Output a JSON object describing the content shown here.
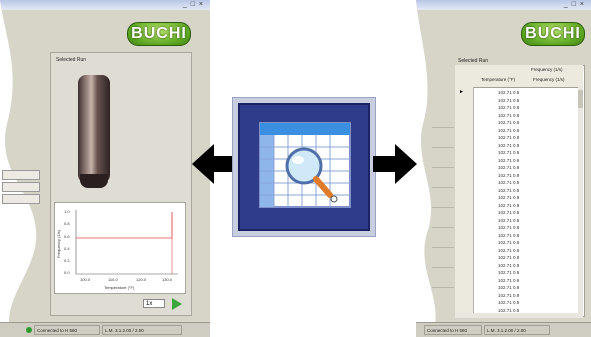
{
  "left_window": {
    "window_controls": "_ □ ×",
    "logo_text": "BUCHI",
    "panel_title": "Selected Run",
    "chart": {
      "ylabel": "Frequency (1/s)",
      "xlabel": "Temperature (°F)",
      "yticks": [
        "1.0",
        "0.8",
        "0.6",
        "0.4",
        "0.2",
        "0.0"
      ],
      "xticks": [
        "100.0",
        "110.0",
        "120.0",
        "130.0"
      ]
    },
    "zoom_value": "1x",
    "side_tabs": [
      "",
      "",
      ""
    ],
    "status": {
      "connection": "Connected to H 560",
      "info": "L.M. 3.1.2.00 / 2.00"
    }
  },
  "right_window": {
    "window_controls": "_ □ ×",
    "logo_text": "BUCHI",
    "panel_title": "Selected Run",
    "columns": [
      "Temperature (°F)",
      "Frequency (1/s)"
    ],
    "column_group": "Frequency (1/s)",
    "row_marker": "►",
    "rows": [
      "102.71 0.9",
      "102.71 0.9",
      "102.71 0.9",
      "102.71 0.9",
      "102.71 0.9",
      "102.71 0.9",
      "102.71 0.9",
      "102.71 0.9",
      "102.71 0.9",
      "102.71 0.9",
      "102.71 0.9",
      "102.71 0.9",
      "102.71 0.9",
      "102.71 0.9",
      "102.71 0.9",
      "102.71 0.9",
      "102.71 0.9",
      "102.71 0.9",
      "102.71 0.9",
      "102.71 0.9",
      "102.71 0.9",
      "102.71 0.9",
      "102.71 0.9",
      "102.71 0.9",
      "102.71 0.9",
      "102.71 0.9",
      "102.71 0.9",
      "102.71 0.9",
      "102.71 0.9",
      "102.71 0.9"
    ],
    "status": {
      "connection": "Connected to H 560",
      "info": "L.M. 3.1.2.00 / 2.00"
    }
  },
  "center_icon": {
    "icon": "table-zoom-icon"
  },
  "colors": {
    "accent_green": "#5aa521",
    "icon_blue": "#2f3c8b",
    "chart_line": "#e04a4a"
  }
}
